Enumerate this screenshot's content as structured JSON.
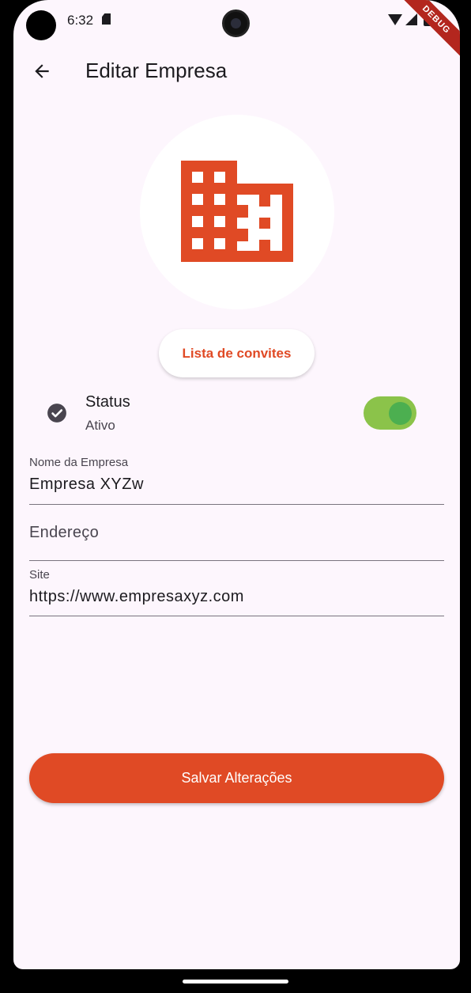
{
  "status_bar": {
    "time": "6:32",
    "icons": [
      "sd-card-icon",
      "wifi-icon",
      "signal-icon",
      "battery-icon"
    ],
    "debug_banner": "DEBUG"
  },
  "app_bar": {
    "back_icon": "arrow-back-icon",
    "title": "Editar Empresa"
  },
  "logo": {
    "icon": "building-icon",
    "color": "#e04a25"
  },
  "invite_button": {
    "label": "Lista de convites"
  },
  "status": {
    "icon": "check-circle-icon",
    "label": "Status",
    "value": "Ativo",
    "enabled": true
  },
  "form": {
    "company_name": {
      "label": "Nome da Empresa",
      "value": "Empresa XYZw"
    },
    "address": {
      "placeholder": "Endereço",
      "value": ""
    },
    "site": {
      "label": "Site",
      "value": "https://www.empresaxyz.com"
    }
  },
  "save_button": {
    "label": "Salvar Alterações"
  },
  "colors": {
    "primary": "#e04a25",
    "background": "#fdf6fd",
    "switch_track": "#8bc34a",
    "switch_thumb": "#4caf50"
  }
}
